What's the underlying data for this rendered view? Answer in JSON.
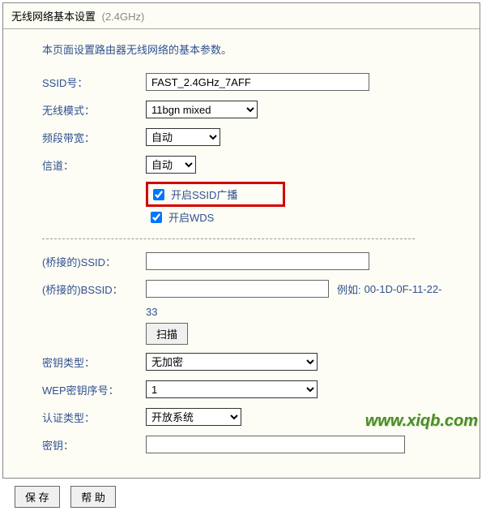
{
  "header": {
    "title": "无线网络基本设置",
    "band": "(2.4GHz)"
  },
  "desc": "本页面设置路由器无线网络的基本参数。",
  "labels": {
    "ssid": "SSID号：",
    "mode": "无线模式：",
    "bandwidth": "频段带宽：",
    "channel": "信道：",
    "enable_ssid": "开启SSID广播",
    "enable_wds": "开启WDS",
    "bridge_ssid": "(桥接的)SSID：",
    "bridge_bssid": "(桥接的)BSSID：",
    "bssid_hint_prefix": "例如:",
    "bssid_hint_value": "00-1D-0F-11-22-33",
    "scan": "扫描",
    "enc_type": "密钥类型：",
    "wep_index": "WEP密钥序号：",
    "auth_type": "认证类型：",
    "key": "密钥："
  },
  "values": {
    "ssid": "FAST_2.4GHz_7AFF",
    "mode": "11bgn mixed",
    "bandwidth": "自动",
    "channel": "自动",
    "ssid_broadcast_checked": true,
    "wds_checked": true,
    "bridge_ssid": "",
    "bridge_bssid": "",
    "enc_type": "无加密",
    "wep_index": "1",
    "auth_type": "开放系统",
    "key": ""
  },
  "options": {
    "mode": [
      "11bgn mixed"
    ],
    "bandwidth": [
      "自动"
    ],
    "channel": [
      "自动"
    ],
    "enc_type": [
      "无加密"
    ],
    "wep_index": [
      "1"
    ],
    "auth_type": [
      "开放系统"
    ]
  },
  "buttons": {
    "save": "保 存",
    "help": "帮 助"
  },
  "watermark": "www.xiqb.com"
}
